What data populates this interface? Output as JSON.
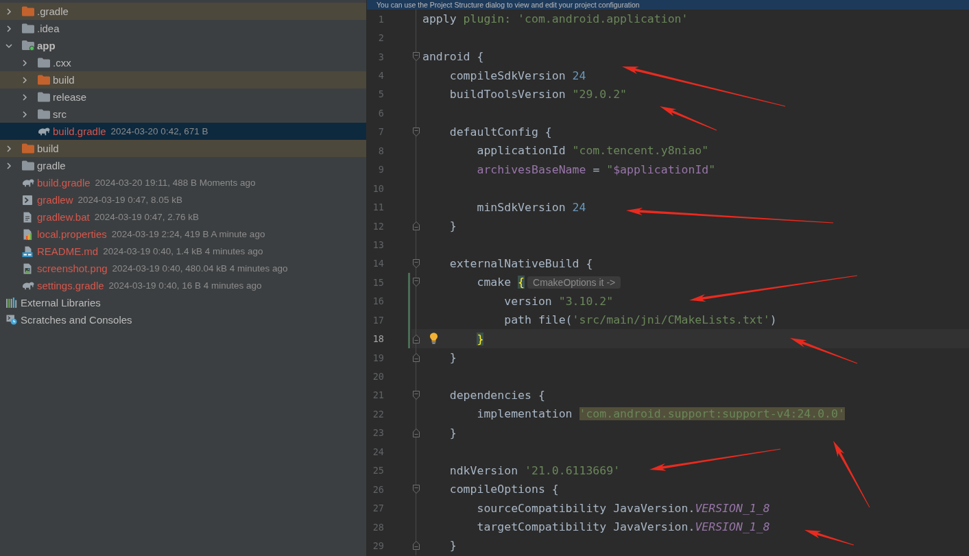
{
  "project_tree": {
    "items": [
      {
        "label": ".gradle",
        "kind": "folder",
        "expanded": false,
        "excluded": true,
        "selected": false,
        "untracked": false
      },
      {
        "label": ".idea",
        "kind": "folder",
        "expanded": false,
        "excluded": false,
        "selected": false,
        "untracked": false
      },
      {
        "label": "app",
        "kind": "module",
        "expanded": true,
        "excluded": false,
        "selected": false,
        "untracked": false,
        "children": [
          {
            "label": ".cxx",
            "kind": "folder",
            "expanded": false,
            "excluded": false,
            "selected": false,
            "untracked": false
          },
          {
            "label": "build",
            "kind": "folder",
            "expanded": false,
            "excluded": true,
            "selected": false,
            "untracked": false
          },
          {
            "label": "release",
            "kind": "folder",
            "expanded": false,
            "excluded": false,
            "selected": false,
            "untracked": false
          },
          {
            "label": "src",
            "kind": "folder",
            "expanded": false,
            "excluded": false,
            "selected": false,
            "untracked": false
          },
          {
            "label": "build.gradle",
            "kind": "gradle",
            "selected": true,
            "untracked": true,
            "info": "2024-03-20 0:42, 671 B"
          }
        ]
      },
      {
        "label": "build",
        "kind": "folder",
        "expanded": false,
        "excluded": true,
        "selected": false,
        "untracked": false
      },
      {
        "label": "gradle",
        "kind": "folder",
        "expanded": false,
        "excluded": false,
        "selected": false,
        "untracked": false
      },
      {
        "label": "build.gradle",
        "kind": "gradle",
        "selected": false,
        "untracked": true,
        "info": "2024-03-20 19:11, 488 B Moments ago"
      },
      {
        "label": "gradlew",
        "kind": "script",
        "selected": false,
        "untracked": true,
        "info": "2024-03-19 0:47, 8.05 kB"
      },
      {
        "label": "gradlew.bat",
        "kind": "text",
        "selected": false,
        "untracked": true,
        "info": "2024-03-19 0:47, 2.76 kB"
      },
      {
        "label": "local.properties",
        "kind": "properties",
        "selected": false,
        "untracked": true,
        "info": "2024-03-19 2:24, 419 B A minute ago"
      },
      {
        "label": "README.md",
        "kind": "markdown",
        "selected": false,
        "untracked": true,
        "info": "2024-03-19 0:40, 1.4 kB 4 minutes ago"
      },
      {
        "label": "screenshot.png",
        "kind": "image",
        "selected": false,
        "untracked": true,
        "info": "2024-03-19 0:40, 480.04 kB 4 minutes ago"
      },
      {
        "label": "settings.gradle",
        "kind": "gradle",
        "selected": false,
        "untracked": true,
        "info": "2024-03-19 0:40, 16 B 4 minutes ago"
      }
    ],
    "extras": [
      {
        "label": "External Libraries",
        "kind": "libraries",
        "selected": false
      },
      {
        "label": "Scratches and Consoles",
        "kind": "scratches",
        "selected": false
      }
    ]
  },
  "editor": {
    "banner": "You can use the Project Structure dialog to view and edit your project configuration",
    "lines": [
      {
        "number": "1",
        "current": false,
        "changed": false,
        "bulb": false,
        "fold_start": false,
        "fold_end": false,
        "tokens": [
          {
            "text": "apply ",
            "kind": "plain"
          },
          {
            "text": "plugin: ",
            "kind": "named"
          },
          {
            "text": "'com.android.application'",
            "kind": "string"
          }
        ]
      },
      {
        "number": "2",
        "current": false,
        "changed": false,
        "bulb": false,
        "fold_start": false,
        "fold_end": false
      },
      {
        "number": "3",
        "current": false,
        "changed": false,
        "bulb": false,
        "fold_start": true,
        "fold_end": false,
        "tokens": [
          {
            "text": "android {",
            "kind": "plain"
          }
        ]
      },
      {
        "number": "4",
        "current": false,
        "changed": false,
        "bulb": false,
        "fold_start": false,
        "fold_end": false,
        "tokens": [
          {
            "text": "    compileSdkVersion ",
            "kind": "plain"
          },
          {
            "text": "24",
            "kind": "number"
          }
        ]
      },
      {
        "number": "5",
        "current": false,
        "changed": false,
        "bulb": false,
        "fold_start": false,
        "fold_end": false,
        "tokens": [
          {
            "text": "    buildToolsVersion ",
            "kind": "plain"
          },
          {
            "text": "\"29.0.2\"",
            "kind": "string"
          }
        ]
      },
      {
        "number": "6",
        "current": false,
        "changed": false,
        "bulb": false,
        "fold_start": false,
        "fold_end": false
      },
      {
        "number": "7",
        "current": false,
        "changed": false,
        "bulb": false,
        "fold_start": true,
        "fold_end": false,
        "tokens": [
          {
            "text": "    defaultConfig {",
            "kind": "plain"
          }
        ]
      },
      {
        "number": "8",
        "current": false,
        "changed": false,
        "bulb": false,
        "fold_start": false,
        "fold_end": false,
        "tokens": [
          {
            "text": "        applicationId ",
            "kind": "plain"
          },
          {
            "text": "\"com.tencent.y8niao\"",
            "kind": "string"
          }
        ]
      },
      {
        "number": "9",
        "current": false,
        "changed": false,
        "bulb": false,
        "fold_start": false,
        "fold_end": false,
        "tokens": [
          {
            "text": "        archivesBaseName",
            "kind": "field"
          },
          {
            "text": " = ",
            "kind": "plain"
          },
          {
            "text": "\"",
            "kind": "string"
          },
          {
            "text": "$applicationId",
            "kind": "field"
          },
          {
            "text": "\"",
            "kind": "string"
          }
        ]
      },
      {
        "number": "10",
        "current": false,
        "changed": false,
        "bulb": false,
        "fold_start": false,
        "fold_end": false
      },
      {
        "number": "11",
        "current": false,
        "changed": false,
        "bulb": false,
        "fold_start": false,
        "fold_end": false,
        "tokens": [
          {
            "text": "        minSdkVersion ",
            "kind": "plain"
          },
          {
            "text": "24",
            "kind": "number"
          }
        ]
      },
      {
        "number": "12",
        "current": false,
        "changed": false,
        "bulb": false,
        "fold_start": false,
        "fold_end": true,
        "tokens": [
          {
            "text": "    }",
            "kind": "plain"
          }
        ]
      },
      {
        "number": "13",
        "current": false,
        "changed": false,
        "bulb": false,
        "fold_start": false,
        "fold_end": false
      },
      {
        "number": "14",
        "current": false,
        "changed": false,
        "bulb": false,
        "fold_start": true,
        "fold_end": false,
        "tokens": [
          {
            "text": "    externalNativeBuild {",
            "kind": "plain"
          }
        ]
      },
      {
        "number": "15",
        "current": false,
        "changed": true,
        "bulb": false,
        "fold_start": true,
        "fold_end": false,
        "tokens": [
          {
            "text": "        cmake ",
            "kind": "plain"
          },
          {
            "text": "{",
            "kind": "brace"
          }
        ],
        "hint": "CmakeOptions it ->"
      },
      {
        "number": "16",
        "current": false,
        "changed": true,
        "bulb": false,
        "fold_start": false,
        "fold_end": false,
        "tokens": [
          {
            "text": "            version ",
            "kind": "plain"
          },
          {
            "text": "\"3.10.2\"",
            "kind": "string"
          }
        ]
      },
      {
        "number": "17",
        "current": false,
        "changed": true,
        "bulb": false,
        "fold_start": false,
        "fold_end": false,
        "tokens": [
          {
            "text": "            path file(",
            "kind": "plain"
          },
          {
            "text": "'src/main/jni/CMakeLists.txt'",
            "kind": "string"
          },
          {
            "text": ")",
            "kind": "plain"
          }
        ]
      },
      {
        "number": "18",
        "current": true,
        "changed": true,
        "bulb": true,
        "fold_start": false,
        "fold_end": true,
        "tokens": [
          {
            "text": "        }",
            "kind": "brace"
          }
        ]
      },
      {
        "number": "19",
        "current": false,
        "changed": false,
        "bulb": false,
        "fold_start": false,
        "fold_end": true,
        "tokens": [
          {
            "text": "    }",
            "kind": "plain"
          }
        ]
      },
      {
        "number": "20",
        "current": false,
        "changed": false,
        "bulb": false,
        "fold_start": false,
        "fold_end": false
      },
      {
        "number": "21",
        "current": false,
        "changed": false,
        "bulb": false,
        "fold_start": true,
        "fold_end": false,
        "tokens": [
          {
            "text": "    dependencies {",
            "kind": "plain"
          }
        ]
      },
      {
        "number": "22",
        "current": false,
        "changed": false,
        "bulb": false,
        "fold_start": false,
        "fold_end": false,
        "tokens": [
          {
            "text": "        implementation ",
            "kind": "plain"
          },
          {
            "text": "'com.android.support:support-v4:24.0.0'",
            "kind": "marked"
          }
        ]
      },
      {
        "number": "23",
        "current": false,
        "changed": false,
        "bulb": false,
        "fold_start": false,
        "fold_end": true,
        "tokens": [
          {
            "text": "    }",
            "kind": "plain"
          }
        ]
      },
      {
        "number": "24",
        "current": false,
        "changed": false,
        "bulb": false,
        "fold_start": false,
        "fold_end": false
      },
      {
        "number": "25",
        "current": false,
        "changed": false,
        "bulb": false,
        "fold_start": false,
        "fold_end": false,
        "tokens": [
          {
            "text": "    ndkVersion ",
            "kind": "plain"
          },
          {
            "text": "'21.0.6113669'",
            "kind": "string"
          }
        ]
      },
      {
        "number": "26",
        "current": false,
        "changed": false,
        "bulb": false,
        "fold_start": true,
        "fold_end": false,
        "tokens": [
          {
            "text": "    compileOptions {",
            "kind": "plain"
          }
        ]
      },
      {
        "number": "27",
        "current": false,
        "changed": false,
        "bulb": false,
        "fold_start": false,
        "fold_end": false,
        "tokens": [
          {
            "text": "        sourceCompatibility JavaVersion.",
            "kind": "plain"
          },
          {
            "text": "VERSION_1_8",
            "kind": "static"
          }
        ]
      },
      {
        "number": "28",
        "current": false,
        "changed": false,
        "bulb": false,
        "fold_start": false,
        "fold_end": false,
        "tokens": [
          {
            "text": "        targetCompatibility JavaVersion.",
            "kind": "plain"
          },
          {
            "text": "VERSION_1_8",
            "kind": "static"
          }
        ]
      },
      {
        "number": "29",
        "current": false,
        "changed": false,
        "bulb": false,
        "fold_start": false,
        "fold_end": true,
        "tokens": [
          {
            "text": "    }",
            "kind": "plain"
          }
        ]
      }
    ]
  }
}
